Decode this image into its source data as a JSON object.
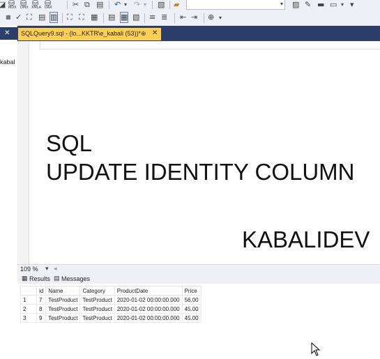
{
  "document_tab": {
    "title": "SQLQuery9.sql - (lo...KKTR\\e_kabali (53))*",
    "pin_glyph": "⊕",
    "close_glyph": "✕"
  },
  "left_panel": {
    "close_glyph": "✕",
    "partial_text": "kabal"
  },
  "toolbar": {
    "execute_labels": [
      "MDX",
      "DMX",
      "XMLA",
      "DAX"
    ],
    "undo_glyph": "↶",
    "redo_glyph": "↷",
    "dropdown_glyph": "▾"
  },
  "editor_overlay": {
    "line1": "SQL",
    "line2": "UPDATE IDENTITY COLUMN",
    "author": "KABALIDEV"
  },
  "zoom": {
    "value": "109 %",
    "dropdown_glyph": "▾"
  },
  "results_tabs": [
    {
      "label": "Results",
      "icon": "grid-icon"
    },
    {
      "label": "Messages",
      "icon": "messages-icon"
    }
  ],
  "results_grid": {
    "columns": [
      "id",
      "Name",
      "Category",
      "ProductDate",
      "Price"
    ],
    "rows": [
      {
        "num": "1",
        "cells": [
          "7",
          "TestProduct",
          "TestProduct",
          "2020-01-02 00:00:00.000",
          "56.00"
        ]
      },
      {
        "num": "2",
        "cells": [
          "8",
          "TestProduct",
          "TestProduct",
          "2020-01-02 00:00:00.000",
          "45.00"
        ]
      },
      {
        "num": "3",
        "cells": [
          "9",
          "TestProduct",
          "TestProduct",
          "2020-01-02 00:00:00.000",
          "45.00"
        ]
      }
    ]
  },
  "colors": {
    "tab_active": "#ffcf54",
    "tab_strip": "#2c3e69",
    "toolbar_bg": "#eef0f5"
  }
}
